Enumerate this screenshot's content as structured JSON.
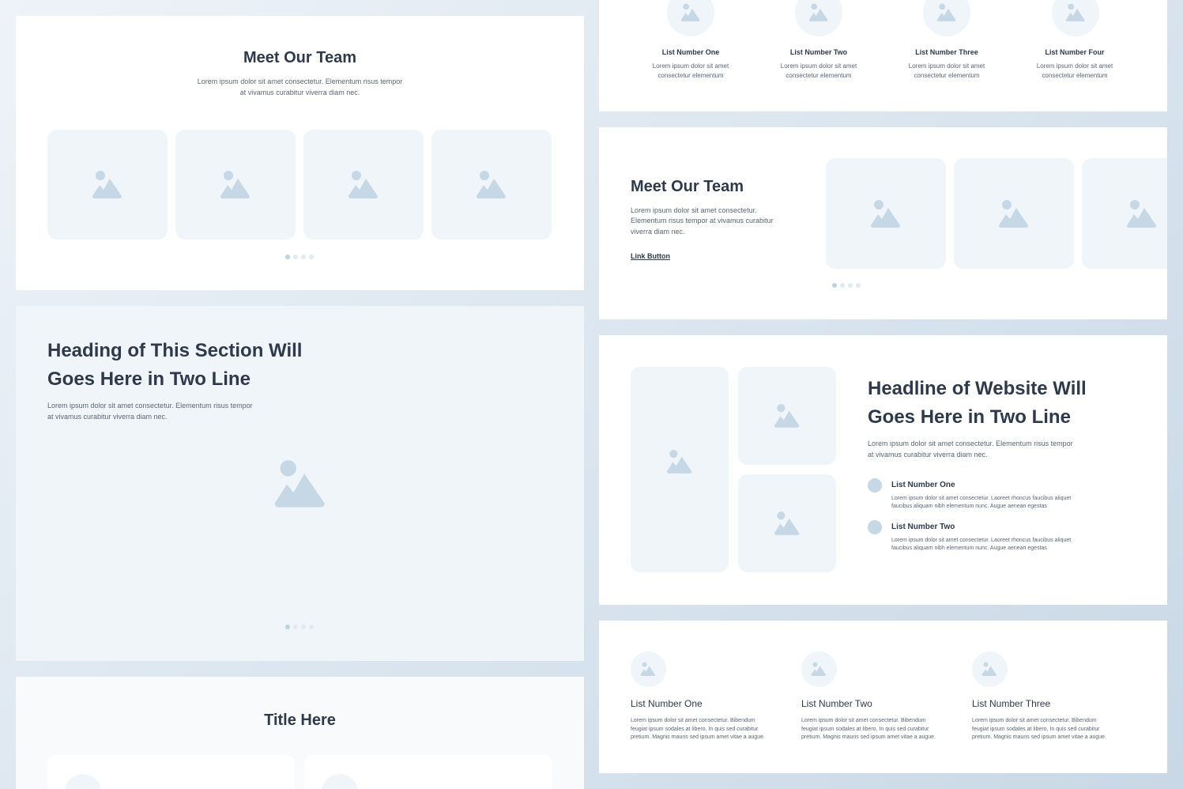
{
  "team_top": {
    "title": "Meet Our Team",
    "desc_line1": "Lorem ipsum dolor sit amet consectetur. Elementum risus tempor",
    "desc_line2": "at vivamus curabitur viverra diam nec."
  },
  "hero": {
    "heading_line1": "Heading of This Section Will",
    "heading_line2": "Goes Here in Two Line",
    "desc_line1": "Lorem ipsum dolor sit amet consectetur. Elementum risus tempor",
    "desc_line2": "at vivamus curabitur viverra diam nec."
  },
  "title_section": {
    "title": "Title Here"
  },
  "icon_list_top": {
    "items": [
      {
        "label": "List Number One",
        "desc_line1": "Lorem ipsum dolor sit amet",
        "desc_line2": "consectetur elementum"
      },
      {
        "label": "List Number Two",
        "desc_line1": "Lorem ipsum dolor sit amet",
        "desc_line2": "consectetur elementum"
      },
      {
        "label": "List Number Three",
        "desc_line1": "Lorem ipsum dolor sit amet",
        "desc_line2": "consectetur elementum"
      },
      {
        "label": "List Number Four",
        "desc_line1": "Lorem ipsum dolor sit amet",
        "desc_line2": "consectetur elementum"
      }
    ]
  },
  "team_right": {
    "title": "Meet Our Team",
    "desc_line1": "Lorem ipsum dolor sit amet consectetur.",
    "desc_line2": "Elementum risus tempor at vivamus curabitur",
    "desc_line3": "viverra diam nec.",
    "link_label": "Link Button"
  },
  "headline": {
    "heading_line1": "Headline of Website Will",
    "heading_line2": "Goes Here in Two Line",
    "desc_line1": "Lorem ipsum dolor sit amet consectetur. Elementum risus tempor",
    "desc_line2": "at vivamus curabitur viverra diam nec.",
    "items": [
      {
        "label": "List Number One",
        "desc_line1": "Lorem ipsum dolor sit amet consectetur. Laoreet rhoncus faucibus aliquet",
        "desc_line2": "faucibus aliquam nibh elementum nunc. Augue aenean egestas"
      },
      {
        "label": "List Number Two",
        "desc_line1": "Lorem ipsum dolor sit amet consectetur. Laoreet rhoncus faucibus aliquet",
        "desc_line2": "faucibus aliquam nibh elementum nunc. Augue aenean egestas"
      }
    ]
  },
  "features": {
    "items": [
      {
        "label": "List Number One",
        "desc_line1": "Lorem ipsum dolor sit amet consectetur. Bibendum",
        "desc_line2": "feugiat ipsum sodales at libero. In quis sed curabitur",
        "desc_line3": "pretium. Magnis mauris sed ipsum amet vitae a augue."
      },
      {
        "label": "List Number Two",
        "desc_line1": "Lorem ipsum dolor sit amet consectetur. Bibendum",
        "desc_line2": "feugiat ipsum sodales at libero. In quis sed curabitur",
        "desc_line3": "pretium. Magnis mauris sed ipsum amet vitae a augue."
      },
      {
        "label": "List Number Three",
        "desc_line1": "Lorem ipsum dolor sit amet consectetur. Bibendum",
        "desc_line2": "feugiat ipsum sodales at libero. In quis sed curabitur",
        "desc_line3": "pretium. Magnis mauris sed ipsum amet vitae a augue."
      }
    ]
  },
  "icons": {
    "placeholder": "image-placeholder-icon",
    "dots": "carousel-dots"
  },
  "colors": {
    "text_dark": "#2e3a4b",
    "text_body": "#5b6678",
    "placeholder_fill": "#f0f5f9",
    "icon_fill": "#c6d7e6",
    "dot_active": "#bcd1e3",
    "dot_inactive": "#e2eaf1"
  }
}
